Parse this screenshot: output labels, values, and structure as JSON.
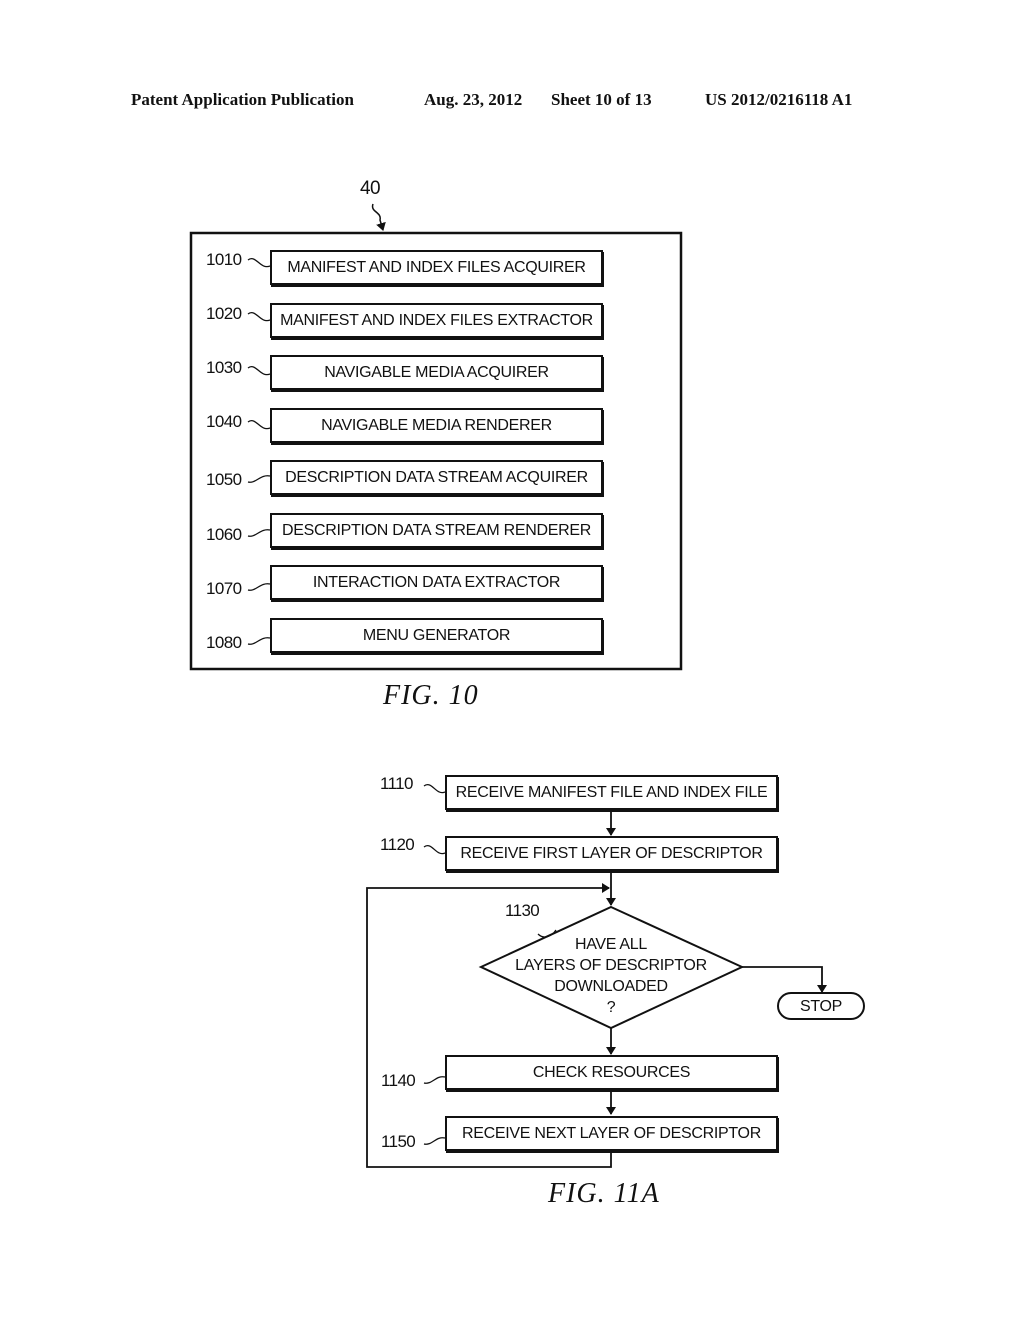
{
  "header": {
    "publication": "Patent Application Publication",
    "date": "Aug. 23, 2012",
    "sheet": "Sheet 10 of 13",
    "number": "US 2012/0216118 A1"
  },
  "fig10": {
    "caption": "FIG. 10",
    "container_ref": "40",
    "modules": [
      {
        "ref": "1010",
        "label": "MANIFEST AND INDEX FILES ACQUIRER"
      },
      {
        "ref": "1020",
        "label": "MANIFEST AND INDEX FILES EXTRACTOR"
      },
      {
        "ref": "1030",
        "label": "NAVIGABLE MEDIA ACQUIRER"
      },
      {
        "ref": "1040",
        "label": "NAVIGABLE MEDIA RENDERER"
      },
      {
        "ref": "1050",
        "label": "DESCRIPTION DATA STREAM ACQUIRER"
      },
      {
        "ref": "1060",
        "label": "DESCRIPTION DATA STREAM RENDERER"
      },
      {
        "ref": "1070",
        "label": "INTERACTION DATA EXTRACTOR"
      },
      {
        "ref": "1080",
        "label": "MENU GENERATOR"
      }
    ]
  },
  "fig11a": {
    "caption": "FIG. 11A",
    "steps": [
      {
        "ref": "1110",
        "label": "RECEIVE MANIFEST FILE AND INDEX FILE"
      },
      {
        "ref": "1120",
        "label": "RECEIVE FIRST LAYER OF DESCRIPTOR"
      },
      {
        "ref": "1140",
        "label": "CHECK RESOURCES"
      },
      {
        "ref": "1150",
        "label": "RECEIVE NEXT LAYER OF DESCRIPTOR"
      }
    ],
    "decision": {
      "ref": "1130",
      "lines": [
        "HAVE ALL",
        "LAYERS OF DESCRIPTOR",
        "DOWNLOADED",
        "?"
      ]
    },
    "terminal": {
      "label": "STOP"
    }
  }
}
